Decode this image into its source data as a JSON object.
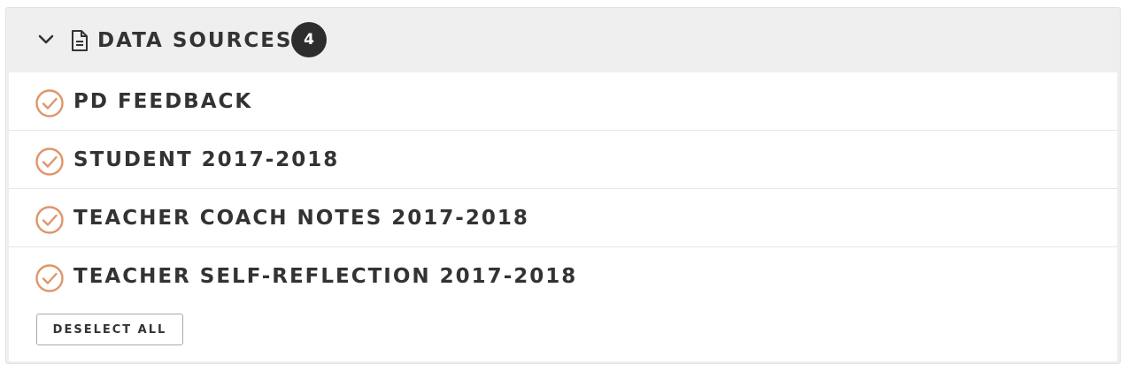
{
  "header": {
    "title": "DATA SOURCES",
    "count": "4",
    "toggle_icon": "chevron-down-icon",
    "section_icon": "document-icon"
  },
  "sources": [
    {
      "label": "PD FEEDBACK",
      "selected": true
    },
    {
      "label": "STUDENT 2017-2018",
      "selected": true
    },
    {
      "label": "TEACHER COACH NOTES 2017-2018",
      "selected": true
    },
    {
      "label": "TEACHER SELF-REFLECTION 2017-2018",
      "selected": true
    }
  ],
  "actions": {
    "deselect_all_label": "DESELECT ALL"
  },
  "colors": {
    "accent": "#e0956a",
    "badge": "#2d2d2d",
    "text": "#333333",
    "header_bg": "#efefef"
  }
}
